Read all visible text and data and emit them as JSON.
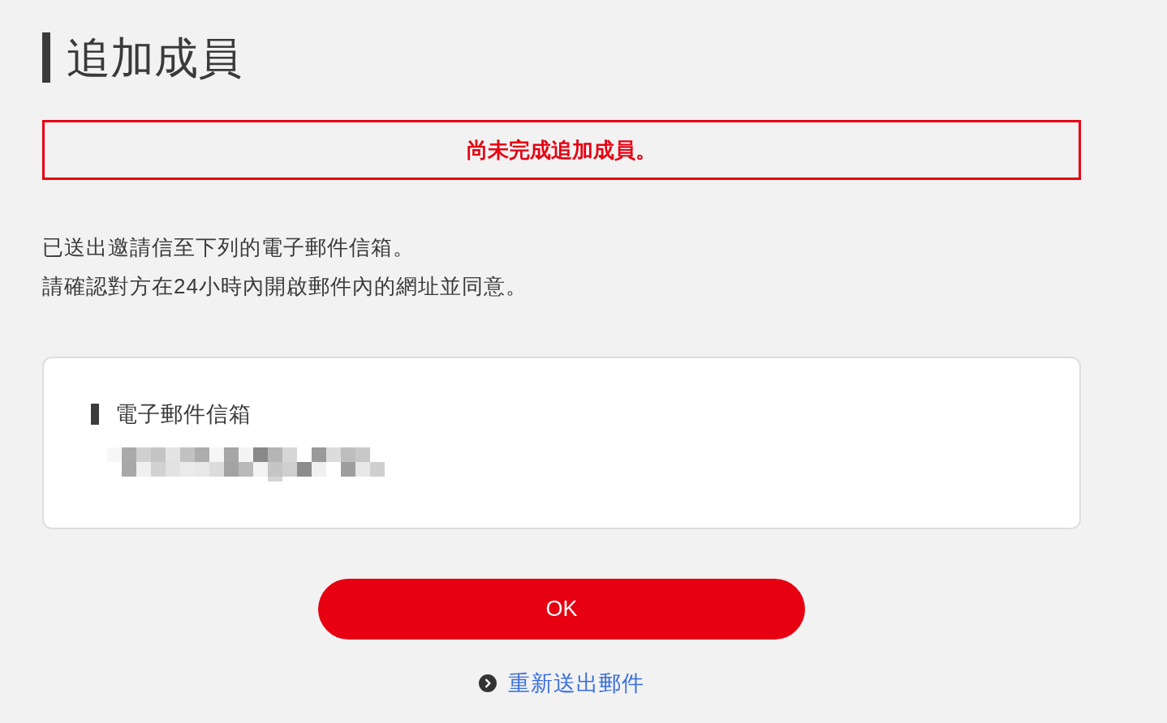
{
  "page": {
    "title": "追加成員"
  },
  "alert": {
    "message": "尚未完成追加成員。"
  },
  "description": [
    "已送出邀請信至下列的電子郵件信箱。",
    "請確認對方在24小時內開啟郵件內的網址並同意。"
  ],
  "email_card": {
    "label": "電子郵件信箱"
  },
  "actions": {
    "ok_button": "OK",
    "resend_link": "重新送出郵件"
  }
}
